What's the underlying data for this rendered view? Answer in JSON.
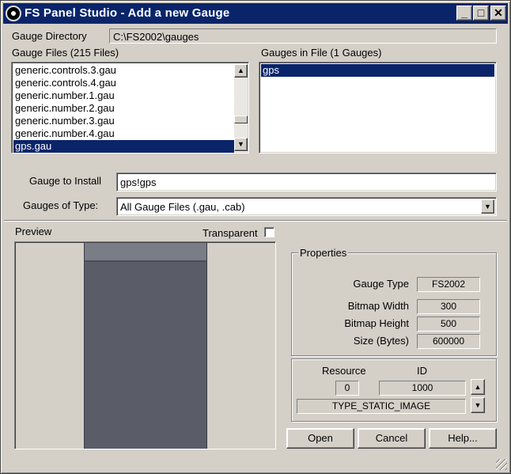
{
  "window": {
    "title": "FS Panel Studio - Add a new Gauge",
    "minimize": "_",
    "maximize": "□",
    "close": "✕"
  },
  "gauge_directory": {
    "label": "Gauge Directory",
    "value": "C:\\FS2002\\gauges"
  },
  "gauge_files": {
    "label": "Gauge Files  (215 Files)",
    "items": [
      "generic.controls.3.gau",
      "generic.controls.4.gau",
      "generic.number.1.gau",
      "generic.number.2.gau",
      "generic.number.3.gau",
      "generic.number.4.gau",
      "gps.gau"
    ],
    "selected_index": 6
  },
  "gauges_in_file": {
    "label": "Gauges in File  (1 Gauges)",
    "items": [
      "gps"
    ],
    "selected_index": 0
  },
  "gauge_to_install": {
    "label": "Gauge to Install",
    "value": "gps!gps"
  },
  "gauges_of_type": {
    "label": "Gauges of Type:",
    "value": "All Gauge Files (.gau, .cab)"
  },
  "preview": {
    "label": "Preview",
    "transparent_label": "Transparent",
    "transparent_checked": false
  },
  "properties": {
    "title": "Properties",
    "gauge_type_label": "Gauge Type",
    "gauge_type_value": "FS2002",
    "bitmap_width_label": "Bitmap Width",
    "bitmap_width_value": "300",
    "bitmap_height_label": "Bitmap Height",
    "bitmap_height_value": "500",
    "size_label": "Size (Bytes)",
    "size_value": "600000"
  },
  "resource": {
    "resource_label": "Resource",
    "id_label": "ID",
    "resource_value": "0",
    "id_value": "1000",
    "type_value": "TYPE_STATIC_IMAGE"
  },
  "buttons": {
    "open": "Open",
    "cancel": "Cancel",
    "help": "Help..."
  },
  "colors": {
    "titlebar": "#0a246a",
    "selection": "#0a246a",
    "face": "#d4d0c8"
  }
}
